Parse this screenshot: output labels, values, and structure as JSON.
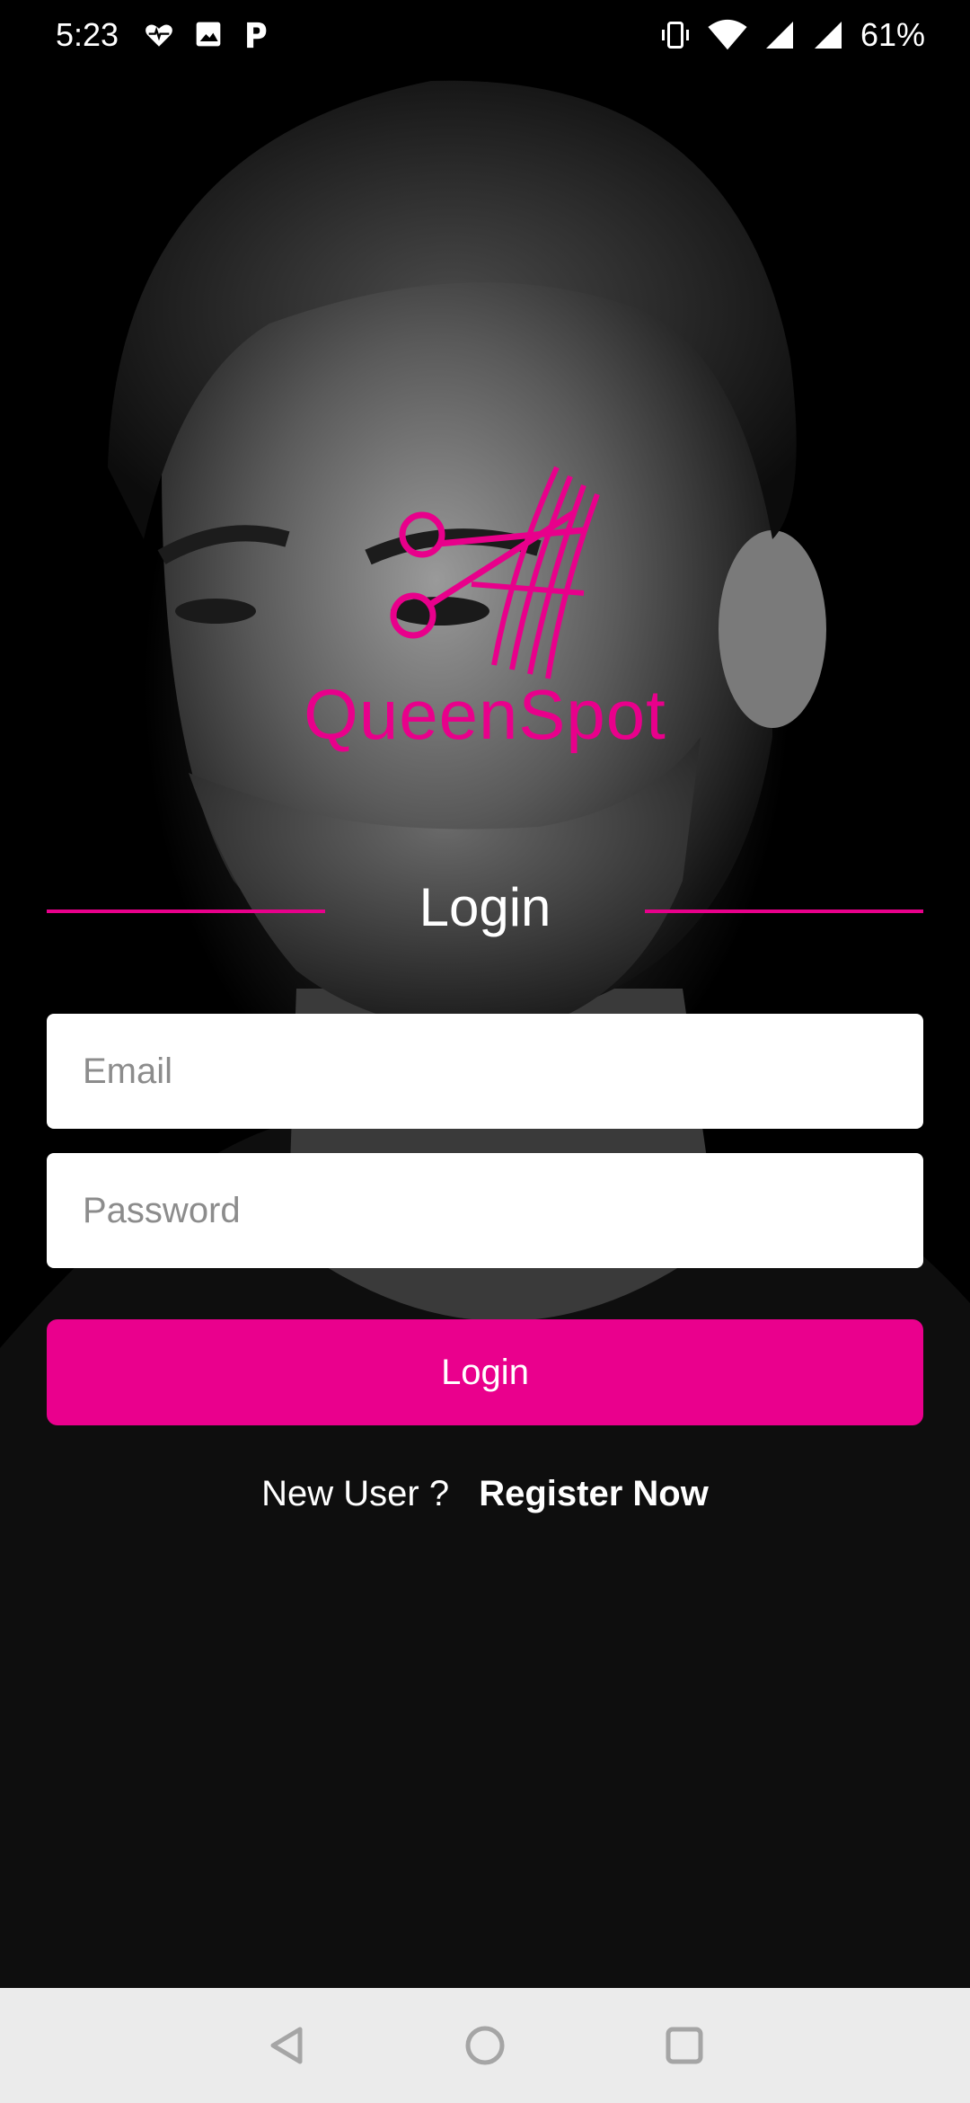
{
  "status_bar": {
    "time": "5:23",
    "battery": "61%",
    "left_icons": [
      "heart-pulse-icon",
      "image-icon",
      "parking-icon"
    ],
    "right_icons": [
      "vibrate-icon",
      "wifi-icon",
      "signal-icon",
      "signal-icon"
    ]
  },
  "brand": {
    "name": "QueenSpot",
    "color": "#e8008b",
    "logo_icon": "scissors-comb-icon"
  },
  "login": {
    "title": "Login",
    "email_placeholder": "Email",
    "password_placeholder": "Password",
    "button_label": "Login",
    "button_color": "#ea008d"
  },
  "register": {
    "prompt": "New User ?",
    "link": "Register Now"
  },
  "nav_bar": {
    "buttons": [
      "back-icon",
      "home-icon",
      "recents-icon"
    ]
  }
}
